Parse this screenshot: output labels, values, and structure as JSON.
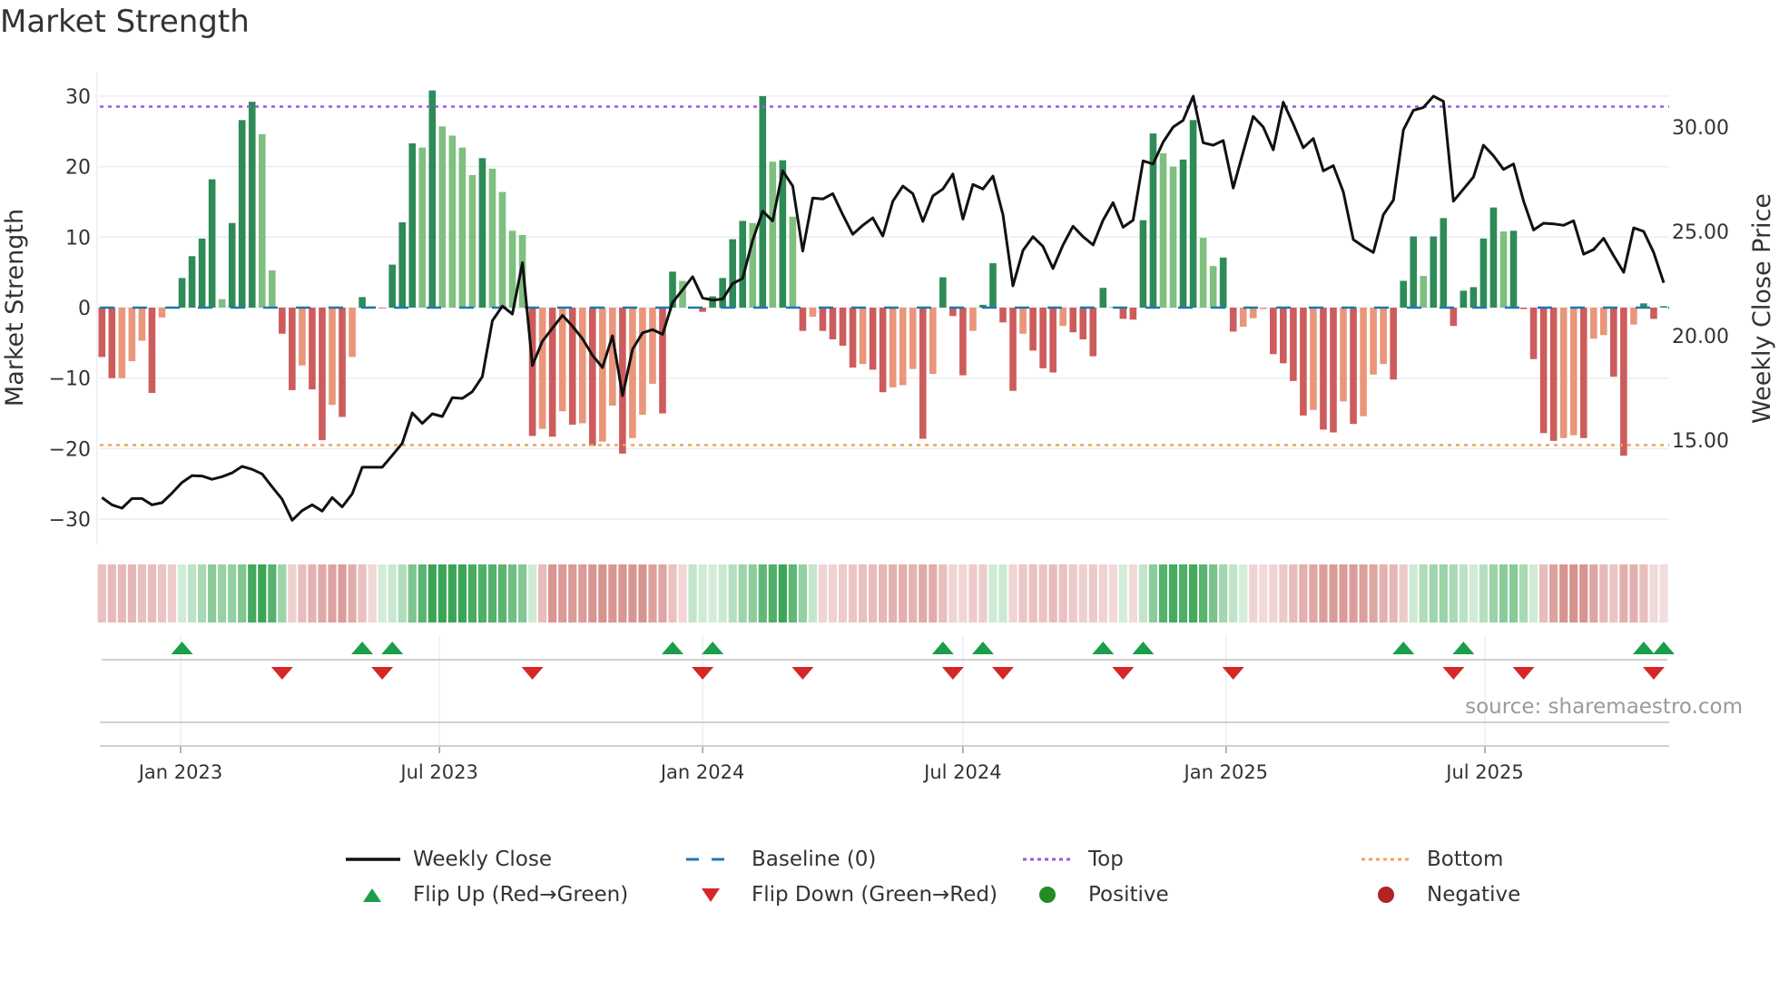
{
  "title": "Market Strength",
  "source": "source: sharemaestro.com",
  "chart_data": {
    "type": "bar",
    "title": "Market Strength",
    "ylabel": "Market Strength",
    "y2label": "Weekly Close Price",
    "ylim": [
      -33,
      33
    ],
    "y2lim": [
      10.27,
      31.9
    ],
    "yticks": [
      30,
      20,
      10,
      0,
      -10,
      -20,
      -30
    ],
    "yticklabels": [
      "30",
      "20",
      "10",
      "0",
      "−10",
      "−20",
      "−30"
    ],
    "y2ticks": [
      30,
      25,
      20,
      15
    ],
    "y2ticklabels": [
      "30.00",
      "25.00",
      "20.00",
      "15.00"
    ],
    "first_week": "2022-11-07",
    "xticks": [
      {
        "date": "2023-01-01",
        "label": "Jan 2023"
      },
      {
        "date": "2023-07-01",
        "label": "Jul 2023"
      },
      {
        "date": "2024-01-01",
        "label": "Jan 2024"
      },
      {
        "date": "2024-07-01",
        "label": "Jul 2024"
      },
      {
        "date": "2025-01-01",
        "label": "Jan 2025"
      },
      {
        "date": "2025-07-01",
        "label": "Jul 2025"
      }
    ],
    "top_level": 28.5,
    "bottom_level": -19.5,
    "baseline": 0,
    "strength": [
      -7.0,
      -10.0,
      -10.0,
      -7.6,
      -4.7,
      -12.1,
      -1.4,
      0,
      4.2,
      7.3,
      9.8,
      18.2,
      1.2,
      12.0,
      26.6,
      29.2,
      24.6,
      5.3,
      -3.7,
      -11.7,
      -8.2,
      -11.6,
      -18.8,
      -13.8,
      -15.5,
      -7.0,
      1.5,
      0.2,
      -0.1,
      6.1,
      12.1,
      23.3,
      22.7,
      30.8,
      25.7,
      24.4,
      22.7,
      18.8,
      21.2,
      19.7,
      16.4,
      10.9,
      10.3,
      -18.2,
      -17.2,
      -18.3,
      -14.7,
      -16.6,
      -16.4,
      -19.6,
      -19.0,
      -13.9,
      -20.7,
      -18.5,
      -15.2,
      -10.8,
      -15.0,
      5.1,
      3.8,
      0.1,
      -0.6,
      1.6,
      4.2,
      9.7,
      12.3,
      12.0,
      30.0,
      20.7,
      20.9,
      12.9,
      -3.3,
      -1.3,
      -3.3,
      -4.5,
      -5.4,
      -8.5,
      -8.0,
      -8.8,
      -12.0,
      -11.3,
      -11.0,
      -8.7,
      -18.6,
      -9.4,
      4.3,
      -1.2,
      -9.6,
      -3.3,
      0.4,
      6.3,
      -2.1,
      -11.8,
      -3.7,
      -6.1,
      -8.6,
      -9.2,
      -2.6,
      -3.5,
      -4.5,
      -6.9,
      2.8,
      0.1,
      -1.6,
      -1.7,
      12.4,
      24.7,
      21.9,
      20.0,
      21.0,
      26.6,
      9.9,
      5.9,
      7.1,
      -3.4,
      -2.7,
      -1.5,
      -0.2,
      -6.6,
      -7.9,
      -10.4,
      -15.3,
      -14.5,
      -17.3,
      -17.7,
      -13.3,
      -16.5,
      -15.4,
      -9.5,
      -8.0,
      -10.2,
      3.8,
      10.1,
      4.5,
      10.1,
      12.7,
      -2.6,
      2.4,
      2.9,
      9.8,
      14.2,
      10.8,
      10.9,
      -0.2,
      -7.3,
      -17.8,
      -18.9,
      -18.5,
      -18.1,
      -18.5,
      -4.4,
      -3.9,
      -9.8,
      -21.0,
      -2.4,
      0.6,
      -1.6,
      0.2
    ],
    "weekly_close": [
      12.25,
      11.9,
      11.74,
      12.2,
      12.2,
      11.9,
      12.0,
      12.46,
      12.97,
      13.3,
      13.28,
      13.12,
      13.25,
      13.43,
      13.74,
      13.6,
      13.38,
      12.76,
      12.17,
      11.16,
      11.62,
      11.9,
      11.6,
      12.25,
      11.8,
      12.43,
      13.7,
      13.7,
      13.7,
      14.27,
      14.85,
      16.3,
      15.8,
      16.26,
      16.13,
      17.03,
      17.0,
      17.32,
      18.04,
      20.72,
      21.42,
      21.04,
      23.5,
      18.58,
      19.74,
      20.36,
      20.98,
      20.46,
      19.86,
      19.06,
      18.48,
      20.0,
      17.13,
      19.35,
      20.14,
      20.29,
      20.07,
      21.59,
      22.2,
      22.83,
      21.81,
      21.71,
      21.76,
      22.5,
      22.75,
      24.57,
      25.97,
      25.5,
      27.9,
      27.17,
      24.06,
      26.6,
      26.55,
      26.81,
      25.8,
      24.86,
      25.29,
      25.65,
      24.78,
      26.45,
      27.17,
      26.81,
      25.48,
      26.7,
      27.03,
      27.75,
      25.59,
      27.25,
      27.03,
      27.65,
      25.8,
      22.39,
      24.09,
      24.75,
      24.28,
      23.22,
      24.35,
      25.25,
      24.75,
      24.35,
      25.54,
      26.38,
      25.2,
      25.54,
      28.38,
      28.23,
      29.28,
      30.0,
      30.32,
      31.48,
      29.25,
      29.13,
      29.35,
      27.08,
      28.81,
      30.51,
      30.0,
      28.91,
      31.19,
      30.14,
      29.01,
      29.45,
      27.9,
      28.15,
      26.89,
      24.61,
      24.28,
      23.99,
      25.8,
      26.5,
      29.86,
      30.8,
      30.94,
      31.48,
      31.23,
      26.45,
      27.03,
      27.61,
      29.13,
      28.62,
      27.97,
      28.23,
      26.45,
      25.07,
      25.39,
      25.36,
      25.29,
      25.51,
      23.91,
      24.13,
      24.67,
      23.84,
      23.04,
      25.17,
      25.0,
      23.99,
      22.54
    ],
    "colors": {
      "pos_strong": "#2e8b57",
      "pos_weak": "#7fbf7f",
      "neg_strong": "#cd5c5c",
      "neg_weak": "#e9967a",
      "line": "#111111",
      "baseline": "#1f77b4",
      "top": "#9b59d6",
      "bottom": "#f0a35e",
      "flip_up": "#1a9e4a",
      "flip_down": "#d62728",
      "positive": "#228b22",
      "negative": "#b22222"
    },
    "legend": [
      {
        "label": "Weekly Close",
        "symbol": "solid-line",
        "color": "#111111"
      },
      {
        "label": "Baseline (0)",
        "symbol": "dash-line",
        "color": "#1f77b4"
      },
      {
        "label": "Top",
        "symbol": "dot-line",
        "color": "#9b59d6"
      },
      {
        "label": "Bottom",
        "symbol": "dot-line",
        "color": "#f0a35e"
      },
      {
        "label": "Flip Up (Red→Green)",
        "symbol": "triangle-up",
        "color": "#1a9e4a"
      },
      {
        "label": "Flip Down (Green→Red)",
        "symbol": "triangle-down",
        "color": "#d62728"
      },
      {
        "label": "Positive",
        "symbol": "circle",
        "color": "#228b22"
      },
      {
        "label": "Negative",
        "symbol": "circle",
        "color": "#b22222"
      }
    ],
    "legend_placement": "bottom"
  }
}
